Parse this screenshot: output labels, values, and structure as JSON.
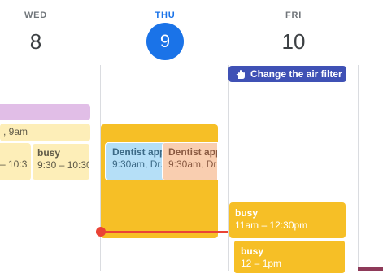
{
  "header": {
    "days": [
      {
        "name": "WED",
        "number": "8"
      },
      {
        "name": "THU",
        "number": "9"
      },
      {
        "name": "FRI",
        "number": "10"
      }
    ]
  },
  "chip": {
    "label": "Change the air filter",
    "icon": "hand-icon",
    "color": "#3f51b5"
  },
  "events": {
    "wed_allday_bar": {
      "color": "#e1bee7"
    },
    "wed_9am": {
      "subtitle": ", 9am"
    },
    "wed_busy_left": {
      "subtitle": "– 10:3"
    },
    "wed_busy_right": {
      "title": "busy",
      "subtitle": "9:30 – 10:30"
    },
    "thu_busy_block": {
      "color": "#f6bf26"
    },
    "thu_dentist_1": {
      "title": "Dentist app",
      "subtitle": "9:30am, Dr."
    },
    "thu_dentist_2": {
      "title": "Dentist app",
      "subtitle": "9:30am, Dr."
    },
    "fri_busy_1": {
      "title": "busy",
      "subtitle": "11am – 12:30pm"
    },
    "fri_busy_2": {
      "title": "busy",
      "subtitle": "12 – 1pm"
    }
  },
  "colors": {
    "today": "#1a73e8",
    "busy": "#f6bf26",
    "tentative": "#fdeeb8",
    "dentist_blue": "#b5dff7",
    "dentist_peach": "#f9ceb0",
    "now_indicator": "#ea4335"
  }
}
